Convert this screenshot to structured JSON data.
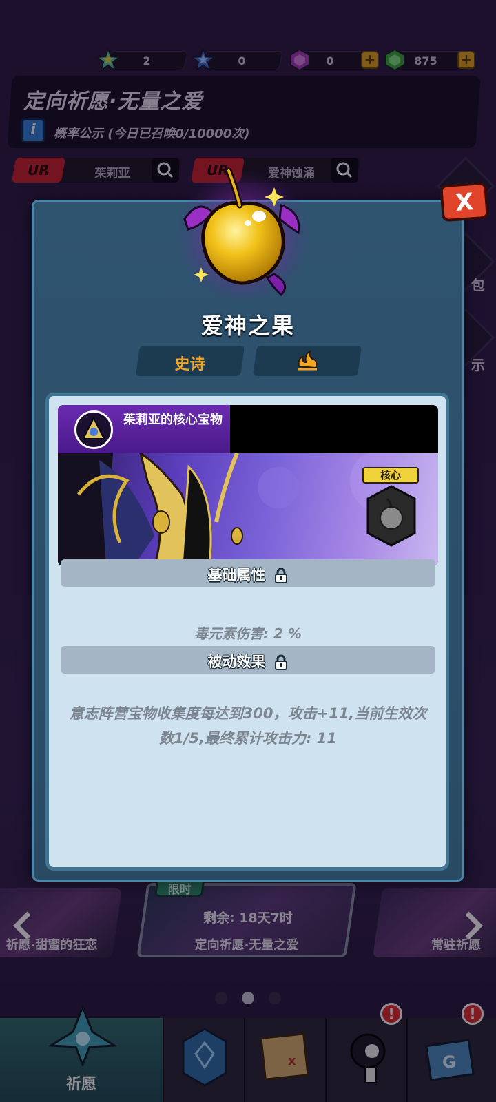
{
  "currency": [
    {
      "icon": "star-colored-icon",
      "value": "2"
    },
    {
      "icon": "star-blue-icon",
      "value": "0"
    },
    {
      "icon": "purple-gem-icon",
      "value": "0"
    },
    {
      "icon": "green-gem-icon",
      "value": "875"
    }
  ],
  "banner": {
    "title": "定向祈愿·无量之爱",
    "probability": "概率公示 (今日已召唤0/10000次)",
    "picks": [
      {
        "rarity": "UR",
        "name": "茱莉亚"
      },
      {
        "rarity": "UR",
        "name": "爱神蚀涌"
      }
    ]
  },
  "side": {
    "label1": "包",
    "label2": "示"
  },
  "modal": {
    "close": "X",
    "item_name": "爱神之果",
    "rarity_tag": "史诗",
    "hero_title": "茱莉亚的核心宝物",
    "core_tag": "核心",
    "base_section": "基础属性",
    "base_attr": "毒元素伤害: 2 %",
    "passive_section": "被动效果",
    "passive_text": "意志阵营宝物收集度每达到300，攻击+11,当前生效次数1/5,最终累计攻击力: 11"
  },
  "carousel": {
    "left_caption": "祈愿·甜蜜的狂恋",
    "center_tag": "限时",
    "center_remaining": "剩余: 18天7时",
    "center_caption": "定向祈愿·无量之爱",
    "right_caption": "常驻祈愿",
    "active_index": 1
  },
  "nav": {
    "items": [
      {
        "label": "祈愿",
        "icon": "wish-crystal-icon"
      },
      {
        "label": "",
        "icon": "blue-card-icon"
      },
      {
        "label": "",
        "icon": "map-scroll-icon"
      },
      {
        "label": "",
        "icon": "character-icon"
      },
      {
        "label": "",
        "icon": "treasure-box-icon"
      }
    ],
    "badge": "!"
  }
}
